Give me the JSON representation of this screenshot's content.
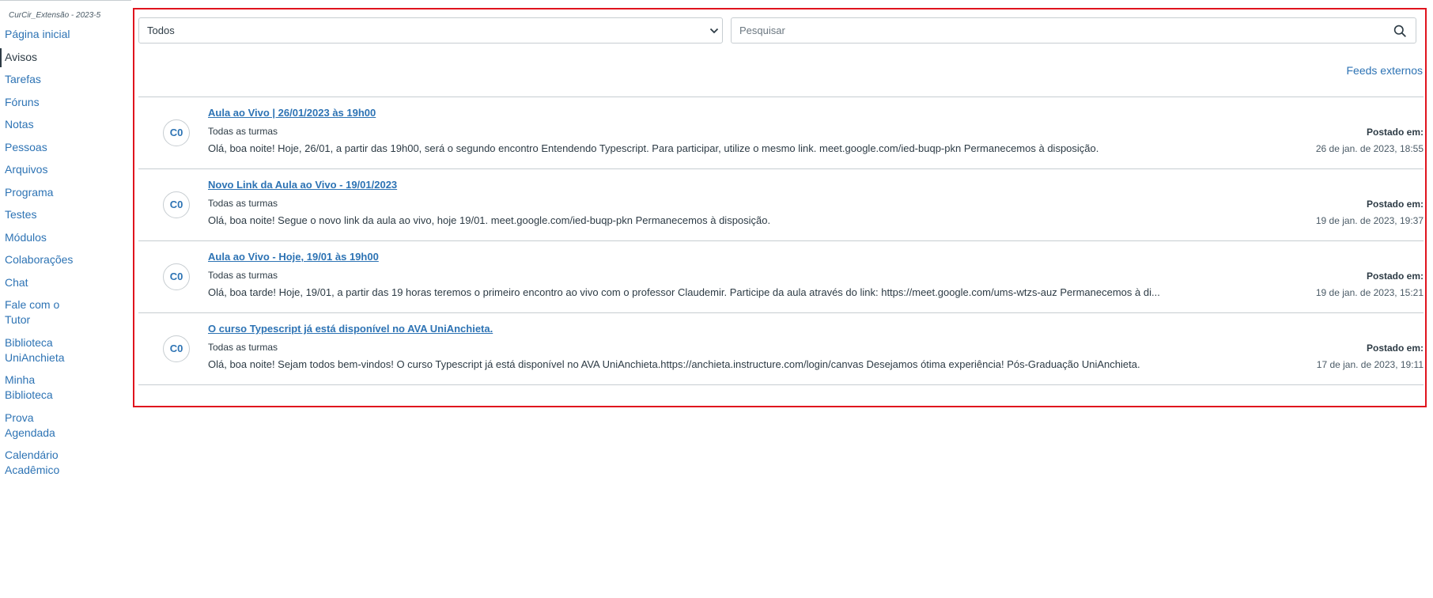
{
  "course": {
    "term_label": "CurCir_Extensão - 2023-5"
  },
  "sidebar": {
    "items": [
      {
        "label": "Página inicial",
        "active": false
      },
      {
        "label": "Avisos",
        "active": true
      },
      {
        "label": "Tarefas",
        "active": false
      },
      {
        "label": "Fóruns",
        "active": false
      },
      {
        "label": "Notas",
        "active": false
      },
      {
        "label": "Pessoas",
        "active": false
      },
      {
        "label": "Arquivos",
        "active": false
      },
      {
        "label": "Programa",
        "active": false
      },
      {
        "label": "Testes",
        "active": false
      },
      {
        "label": "Módulos",
        "active": false
      },
      {
        "label": "Colaborações",
        "active": false
      },
      {
        "label": "Chat",
        "active": false
      },
      {
        "label": "Fale com o Tutor",
        "active": false
      },
      {
        "label": "Biblioteca UniAnchieta",
        "active": false
      },
      {
        "label": "Minha Biblioteca",
        "active": false
      },
      {
        "label": "Prova Agendada",
        "active": false
      },
      {
        "label": "Calendário Acadêmico",
        "active": false
      }
    ]
  },
  "filter": {
    "selected": "Todos",
    "icon": "chevron-down-icon"
  },
  "search": {
    "placeholder": "Pesquisar",
    "value": "",
    "icon": "search-icon"
  },
  "feeds_link": "Feeds externos",
  "announcements": [
    {
      "avatar": "C0",
      "title": "Aula ao Vivo | 26/01/2023 às 19h00",
      "sections": "Todas as turmas",
      "message": "Olá, boa noite! Hoje, 26/01, a partir das 19h00, será o segundo encontro Entendendo Typescript. Para participar, utilize o mesmo link. meet.google.com/ied-buqp-pkn Permanecemos à disposição.",
      "posted_label": "Postado em:",
      "posted_date": "26 de jan. de 2023, 18:55"
    },
    {
      "avatar": "C0",
      "title": "Novo Link da Aula ao Vivo - 19/01/2023",
      "sections": "Todas as turmas",
      "message": "Olá, boa noite! Segue o novo link da aula ao vivo, hoje 19/01.  meet.google.com/ied-buqp-pkn Permanecemos à disposição.",
      "posted_label": "Postado em:",
      "posted_date": "19 de jan. de 2023, 19:37"
    },
    {
      "avatar": "C0",
      "title": "Aula ao Vivo - Hoje, 19/01 às 19h00",
      "sections": "Todas as turmas",
      "message": "Olá, boa tarde! Hoje, 19/01, a partir das 19 horas teremos o primeiro encontro ao vivo com o professor Claudemir. Participe da aula através do link: https://meet.google.com/ums-wtzs-auz Permanecemos à di...",
      "posted_label": "Postado em:",
      "posted_date": "19 de jan. de 2023, 15:21"
    },
    {
      "avatar": "C0",
      "title": "O curso Typescript já está disponível no AVA UniAnchieta.",
      "sections": "Todas as turmas",
      "message": "Olá, boa noite! Sejam todos bem-vindos! O curso Typescript já está disponível no AVA UniAnchieta.https://anchieta.instructure.com/login/canvas Desejamos ótima experiência! Pós-Graduação UniAnchieta.",
      "posted_label": "Postado em:",
      "posted_date": "17 de jan. de 2023, 19:11"
    }
  ],
  "colors": {
    "link": "#2d73b4",
    "text": "#2d3b45",
    "border": "#c7cdd1",
    "highlight_border": "#e0141e"
  }
}
